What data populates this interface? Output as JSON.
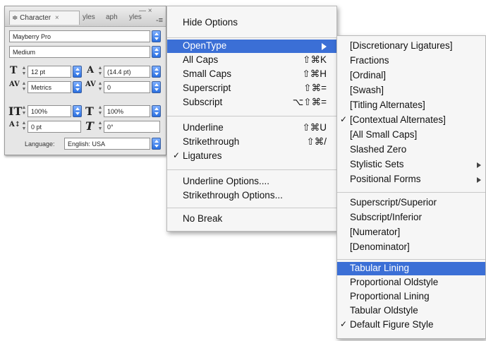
{
  "character_panel": {
    "tabs": [
      "Character",
      "yles",
      "aph",
      "yles"
    ],
    "tab_close": "×",
    "tab_prefix": "≑",
    "panel_menu_icon": "-≡",
    "window_controls": "— ×",
    "font_family": "Mayberry Pro",
    "font_style": "Medium",
    "font_size": "12 pt",
    "leading": "(14.4 pt)",
    "kerning": "Metrics",
    "tracking": "0",
    "vertical_scale": "100%",
    "horizontal_scale": "100%",
    "baseline_shift": "0 pt",
    "skew": "0°",
    "language_label": "Language:",
    "language": "English: USA"
  },
  "main_menu": {
    "items": [
      {
        "label": "Hide Options",
        "shortcut": "",
        "checked": false,
        "highlighted": false,
        "submenu": false
      },
      {
        "label": "OpenType",
        "shortcut": "",
        "checked": false,
        "highlighted": true,
        "submenu": true
      },
      {
        "label": "All Caps",
        "shortcut": "⇧⌘K",
        "checked": false,
        "highlighted": false,
        "submenu": false
      },
      {
        "label": "Small Caps",
        "shortcut": "⇧⌘H",
        "checked": false,
        "highlighted": false,
        "submenu": false
      },
      {
        "label": "Superscript",
        "shortcut": "⇧⌘=",
        "checked": false,
        "highlighted": false,
        "submenu": false
      },
      {
        "label": "Subscript",
        "shortcut": "⌥⇧⌘=",
        "checked": false,
        "highlighted": false,
        "submenu": false
      },
      {
        "label": "Underline",
        "shortcut": "⇧⌘U",
        "checked": false,
        "highlighted": false,
        "submenu": false
      },
      {
        "label": "Strikethrough",
        "shortcut": "⇧⌘/",
        "checked": false,
        "highlighted": false,
        "submenu": false
      },
      {
        "label": "Ligatures",
        "shortcut": "",
        "checked": true,
        "highlighted": false,
        "submenu": false
      },
      {
        "label": "Underline Options....",
        "shortcut": "",
        "checked": false,
        "highlighted": false,
        "submenu": false
      },
      {
        "label": "Strikethrough Options...",
        "shortcut": "",
        "checked": false,
        "highlighted": false,
        "submenu": false
      },
      {
        "label": "No Break",
        "shortcut": "",
        "checked": false,
        "highlighted": false,
        "submenu": false
      }
    ]
  },
  "opentype_submenu": {
    "items": [
      {
        "label": "[Discretionary Ligatures]",
        "checked": false,
        "highlighted": false,
        "submenu": false
      },
      {
        "label": "Fractions",
        "checked": false,
        "highlighted": false,
        "submenu": false
      },
      {
        "label": "[Ordinal]",
        "checked": false,
        "highlighted": false,
        "submenu": false
      },
      {
        "label": "[Swash]",
        "checked": false,
        "highlighted": false,
        "submenu": false
      },
      {
        "label": "[Titling Alternates]",
        "checked": false,
        "highlighted": false,
        "submenu": false
      },
      {
        "label": "[Contextual Alternates]",
        "checked": true,
        "highlighted": false,
        "submenu": false
      },
      {
        "label": "[All Small Caps]",
        "checked": false,
        "highlighted": false,
        "submenu": false
      },
      {
        "label": "Slashed Zero",
        "checked": false,
        "highlighted": false,
        "submenu": false
      },
      {
        "label": "Stylistic Sets",
        "checked": false,
        "highlighted": false,
        "submenu": true
      },
      {
        "label": "Positional Forms",
        "checked": false,
        "highlighted": false,
        "submenu": true
      },
      {
        "label": "Superscript/Superior",
        "checked": false,
        "highlighted": false,
        "submenu": false
      },
      {
        "label": "Subscript/Inferior",
        "checked": false,
        "highlighted": false,
        "submenu": false
      },
      {
        "label": "[Numerator]",
        "checked": false,
        "highlighted": false,
        "submenu": false
      },
      {
        "label": "[Denominator]",
        "checked": false,
        "highlighted": false,
        "submenu": false
      },
      {
        "label": "Tabular Lining",
        "checked": false,
        "highlighted": true,
        "submenu": false
      },
      {
        "label": "Proportional Oldstyle",
        "checked": false,
        "highlighted": false,
        "submenu": false
      },
      {
        "label": "Proportional Lining",
        "checked": false,
        "highlighted": false,
        "submenu": false
      },
      {
        "label": "Tabular Oldstyle",
        "checked": false,
        "highlighted": false,
        "submenu": false
      },
      {
        "label": "Default Figure Style",
        "checked": true,
        "highlighted": false,
        "submenu": false
      }
    ]
  },
  "check_glyph": "✓",
  "colors": {
    "highlight": "#3b6fd6",
    "popup_button": "#2a6fe0"
  }
}
